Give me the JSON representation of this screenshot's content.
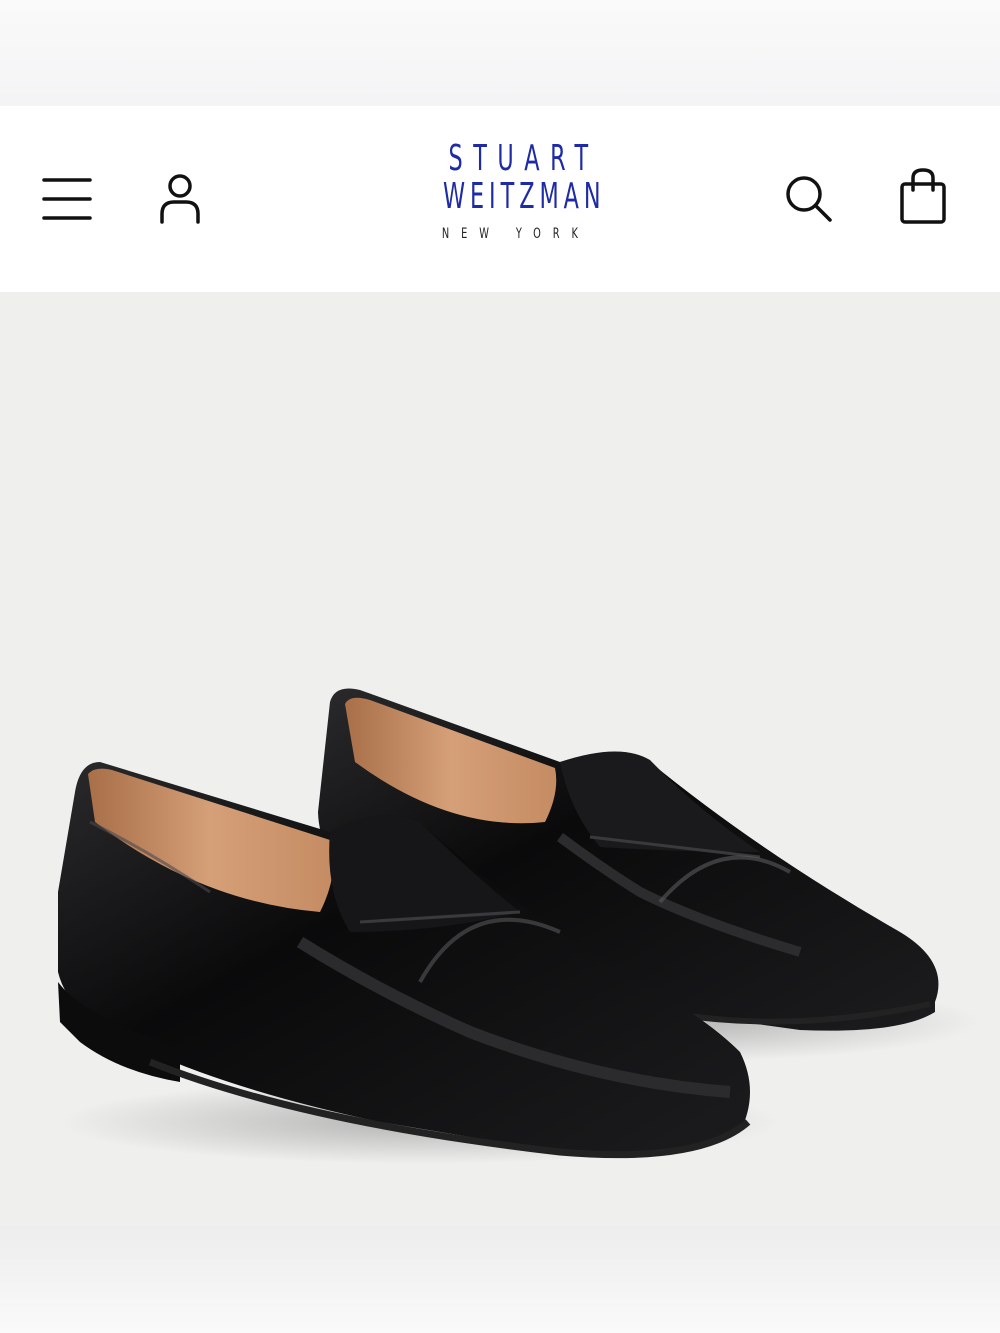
{
  "header": {
    "brand": {
      "line1": "STUART",
      "line2": "WEITZMAN",
      "line3": "NEW YORK",
      "color": "#1f2aa6"
    },
    "icons": {
      "menu": "hamburger-menu-icon",
      "account": "user-icon",
      "search": "search-icon",
      "bag": "shopping-bag-icon"
    }
  },
  "hero": {
    "subject": "black patent penny loafer pair",
    "colors": {
      "background": "#efefee",
      "leather": "#0b0b0c",
      "lining": "#c99369"
    }
  }
}
